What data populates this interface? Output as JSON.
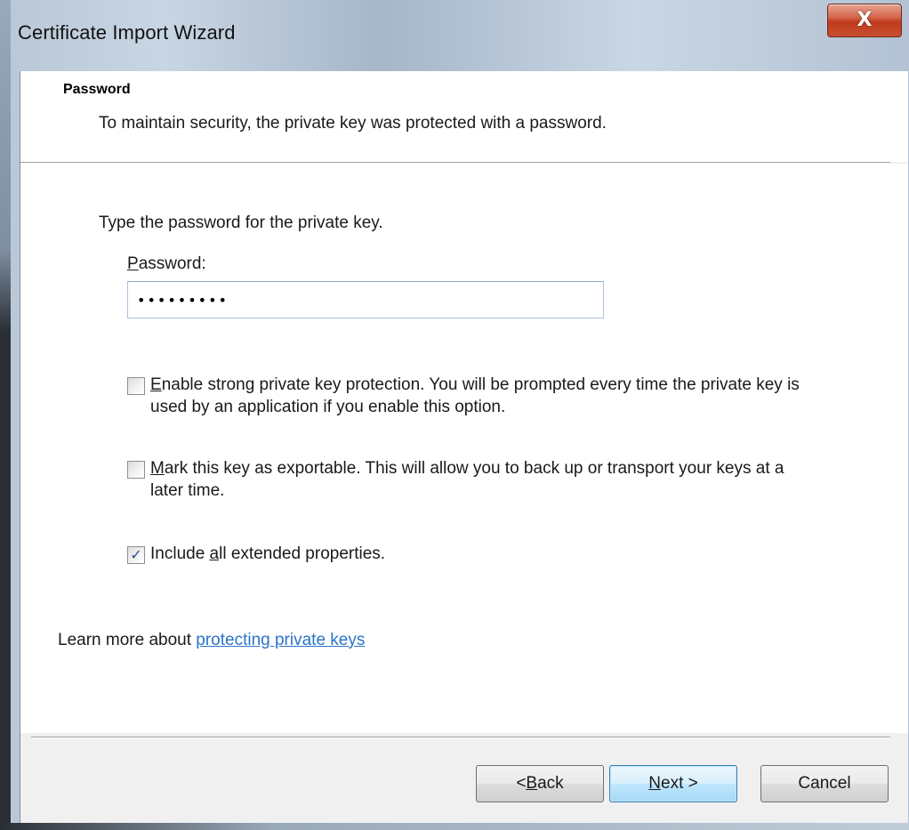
{
  "window": {
    "title": "Certificate Import Wizard",
    "close_glyph": "X"
  },
  "header": {
    "title": "Password",
    "subtitle": "To maintain security, the private key was protected with a password."
  },
  "form": {
    "prompt": "Type the password for the private key.",
    "password_label_accel": "P",
    "password_label_rest": "assword:",
    "password_value": "•••••••••"
  },
  "options": [
    {
      "checked": false,
      "accel": "E",
      "text_rest": "nable strong private key protection. You will be prompted every time the private key is used by an application if you enable this option."
    },
    {
      "checked": false,
      "accel": "M",
      "text_rest": "ark this key as exportable. This will allow you to back up or transport your keys at a later time."
    },
    {
      "checked": true,
      "text_pre": "Include ",
      "accel": "a",
      "text_rest": "ll extended properties."
    }
  ],
  "learn_more": {
    "prefix": "Learn more about ",
    "link_text": "protecting private keys"
  },
  "buttons": {
    "back_pre": "< ",
    "back_accel": "B",
    "back_rest": "ack",
    "next_accel": "N",
    "next_rest": "ext >",
    "cancel": "Cancel"
  },
  "colors": {
    "link": "#2b74c7",
    "checkmark": "#2d4f95",
    "close_button": "#c8502f",
    "default_button_border": "#3c7fb1"
  },
  "icons": {
    "close": "close-icon",
    "checkmark": "checkmark-icon"
  }
}
